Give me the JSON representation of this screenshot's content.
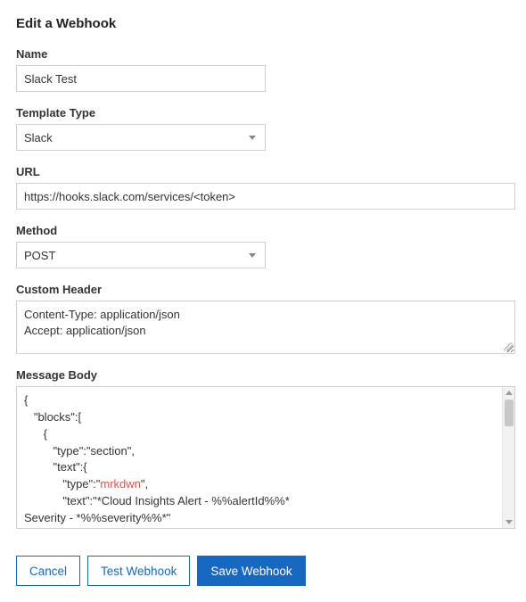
{
  "title": "Edit a Webhook",
  "fields": {
    "name": {
      "label": "Name",
      "value": "Slack Test"
    },
    "templateType": {
      "label": "Template Type",
      "value": "Slack"
    },
    "url": {
      "label": "URL",
      "value": "https://hooks.slack.com/services/<token>"
    },
    "method": {
      "label": "Method",
      "value": "POST"
    },
    "customHeader": {
      "label": "Custom Header",
      "value": "Content-Type: application/json\nAccept: application/json"
    },
    "messageBody": {
      "label": "Message Body",
      "value": "{\n   \"blocks\":[\n      {\n         \"type\":\"section\",\n         \"text\":{\n            \"type\":\"mrkdwn\",\n            \"text\":\"*Cloud Insights Alert - %%alertId%%*\nSeverity - *%%severity%%*\"\n         }\n      },\n      {",
      "highlight": "mrkdwn"
    }
  },
  "buttons": {
    "cancel": "Cancel",
    "test": "Test Webhook",
    "save": "Save Webhook"
  }
}
